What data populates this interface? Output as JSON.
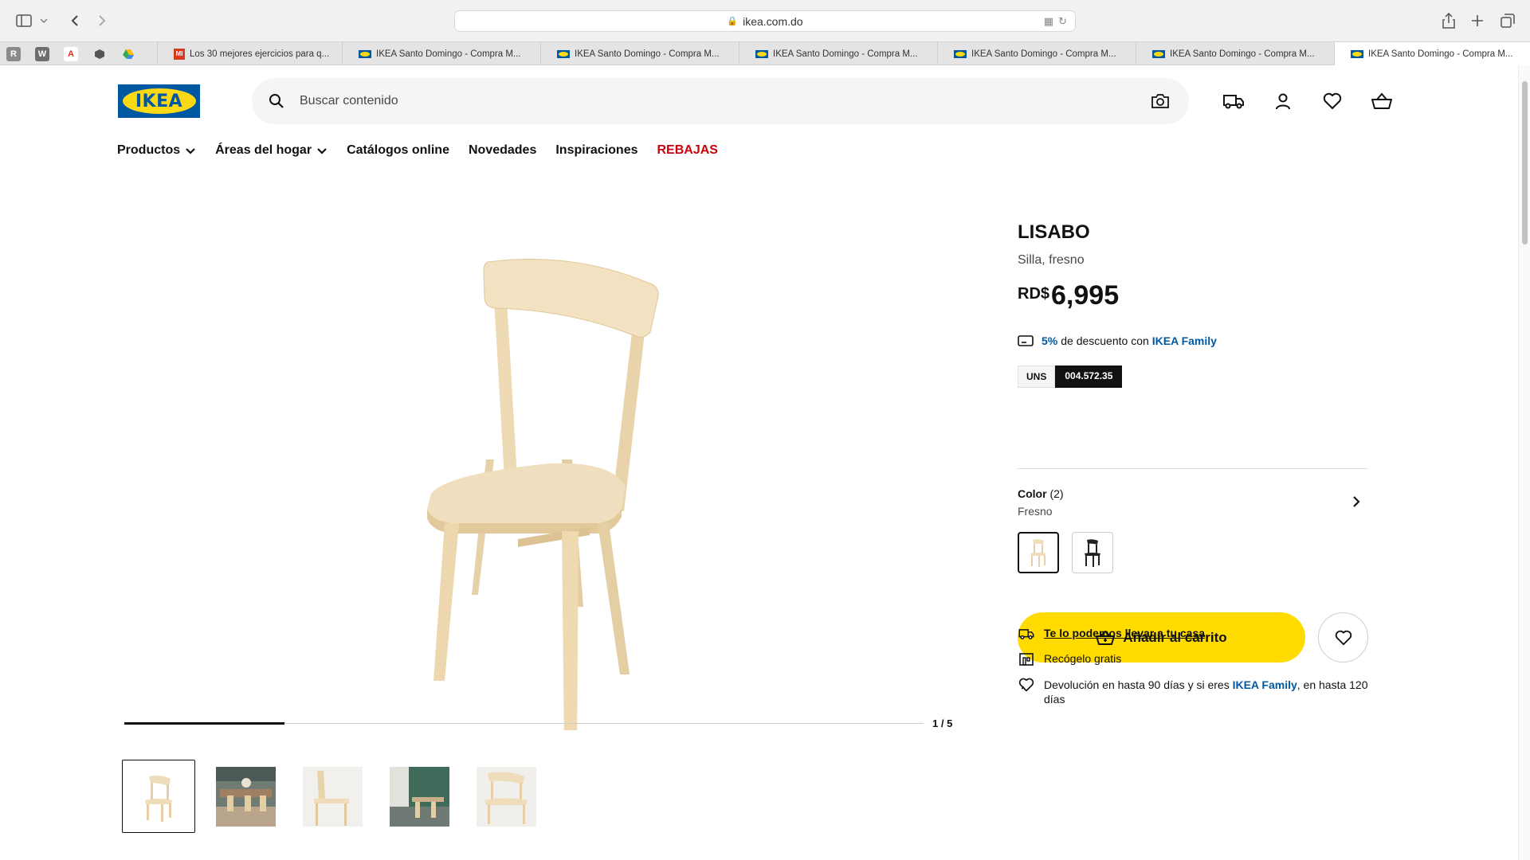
{
  "browser": {
    "url": "ikea.com.do",
    "pinned_tabs": [
      {
        "letter": "R",
        "color": "#8a8a8a"
      },
      {
        "letter": "W",
        "color": "#6e6e6e"
      },
      {
        "letter": "A",
        "color": "#e0301e"
      },
      {
        "letter": "",
        "color": "#555555"
      },
      {
        "letter": "",
        "color": "#34a853"
      }
    ],
    "tabs": [
      {
        "title": "Los 30 mejores ejercicios para q...",
        "favicon": "red-square"
      },
      {
        "title": "IKEA Santo Domingo - Compra M...",
        "favicon": "ikea"
      },
      {
        "title": "IKEA Santo Domingo - Compra M...",
        "favicon": "ikea"
      },
      {
        "title": "IKEA Santo Domingo - Compra M...",
        "favicon": "ikea"
      },
      {
        "title": "IKEA Santo Domingo - Compra M...",
        "favicon": "ikea"
      },
      {
        "title": "IKEA Santo Domingo - Compra M...",
        "favicon": "ikea"
      },
      {
        "title": "IKEA Santo Domingo - Compra M...",
        "favicon": "ikea"
      }
    ]
  },
  "header": {
    "logo_text": "IKEA",
    "search_placeholder": "Buscar contenido",
    "icons": [
      "delivery-truck-icon",
      "account-icon",
      "wishlist-heart-icon",
      "shopping-basket-icon"
    ]
  },
  "nav": {
    "items": [
      {
        "label": "Productos",
        "dropdown": true
      },
      {
        "label": "Áreas del hogar",
        "dropdown": true
      },
      {
        "label": "Catálogos online",
        "dropdown": false
      },
      {
        "label": "Novedades",
        "dropdown": false
      },
      {
        "label": "Inspiraciones",
        "dropdown": false
      },
      {
        "label": "REBAJAS",
        "dropdown": false,
        "highlight": "#cc0008"
      }
    ]
  },
  "gallery": {
    "counter": "1 / 5",
    "progress_fraction": 0.2,
    "thumbnails": [
      {
        "name": "thumb-chair-front",
        "selected": true
      },
      {
        "name": "thumb-dining-room",
        "selected": false
      },
      {
        "name": "thumb-chair-side",
        "selected": false
      },
      {
        "name": "thumb-green-room",
        "selected": false
      },
      {
        "name": "thumb-chair-angle",
        "selected": false
      }
    ]
  },
  "product": {
    "name": "LISABO",
    "description": "Silla, fresno",
    "currency": "RD$",
    "price": "6,995",
    "family_discount_pct": "5%",
    "family_discount_text": "de descuento con",
    "family_program": "IKEA Family",
    "unit_label": "UNS",
    "article_number": "004.572.35",
    "color_label": "Color",
    "color_count": "(2)",
    "color_value": "Fresno",
    "add_to_cart": "Añadir al carrito",
    "delivery_text": "Te lo podemos llevar a tu casa",
    "pickup_text": "Recógelo gratis",
    "return_text_a": "Devolución en hasta 90 días y si eres",
    "return_link": "IKEA Family",
    "return_text_b": ", en hasta 120 días"
  },
  "colors": {
    "brand_blue": "#0058a3",
    "brand_yellow": "#fbd914",
    "button_yellow": "#ffdb00",
    "sale_red": "#cc0008",
    "wood": "#efdcb8"
  }
}
